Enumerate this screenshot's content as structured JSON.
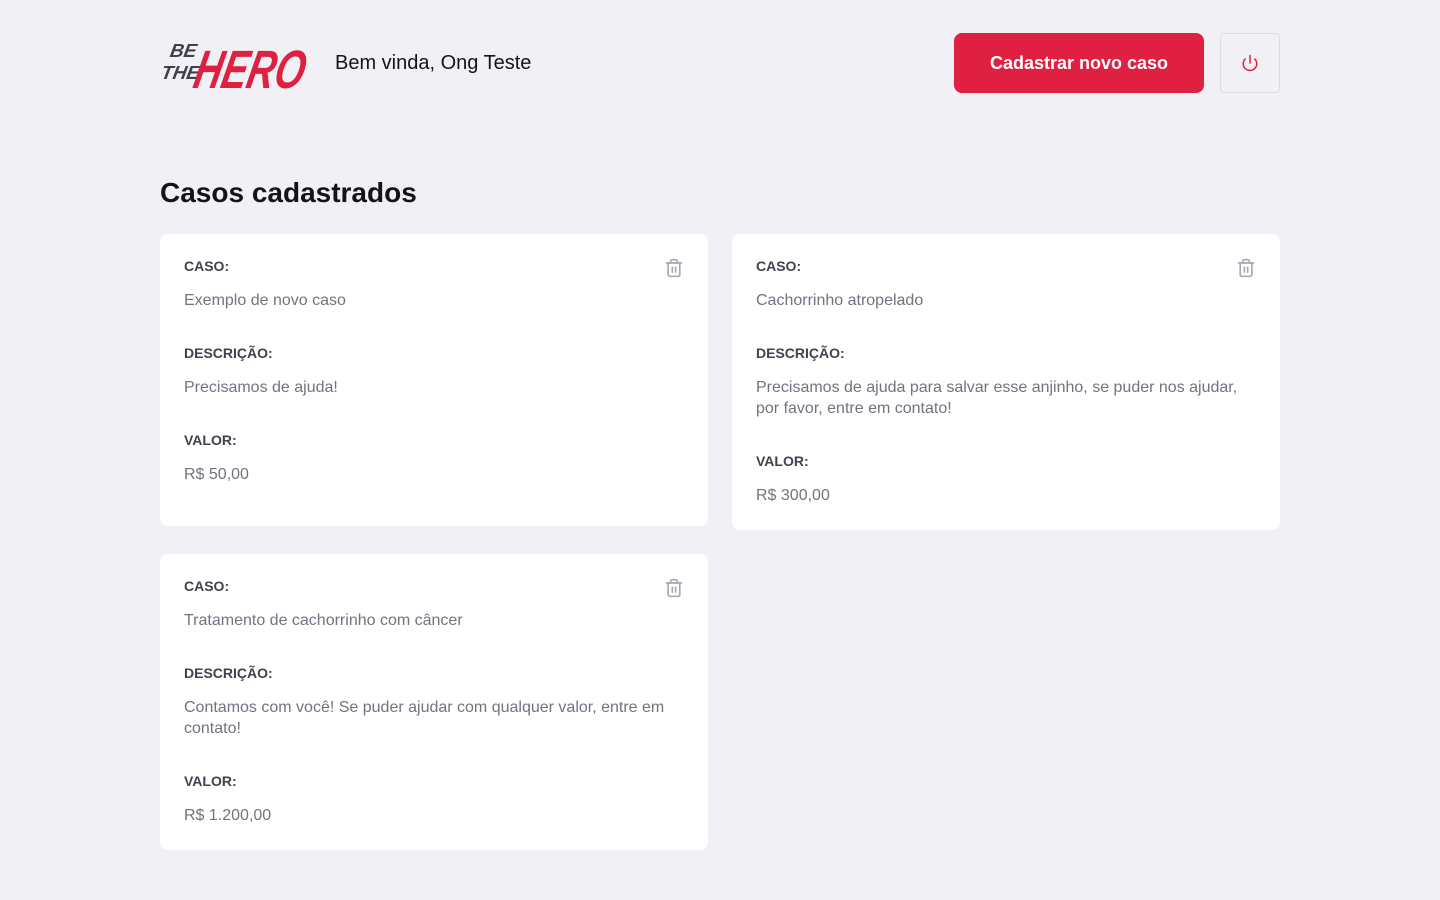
{
  "header": {
    "logo_alt": "Be The Hero",
    "logo_word_small_1": "BE",
    "logo_word_small_2": "THE",
    "logo_word_big": "HERO",
    "welcome": "Bem vinda, Ong Teste",
    "new_case_label": "Cadastrar novo caso",
    "logout_icon": "power-icon"
  },
  "page_title": "Casos cadastrados",
  "labels": {
    "case": "CASO:",
    "description": "DESCRIÇÃO:",
    "value": "VALOR:"
  },
  "cases": [
    {
      "title": "Exemplo de novo caso",
      "description": "Precisamos de ajuda!",
      "value": "R$ 50,00"
    },
    {
      "title": "Cachorrinho atropelado",
      "description": "Precisamos de ajuda para salvar esse anjinho, se puder nos ajudar, por favor, entre em contato!",
      "value": "R$ 300,00"
    },
    {
      "title": "Tratamento de cachorrinho com câncer",
      "description": "Contamos com você! Se puder ajudar com qualquer valor, entre em contato!",
      "value": "R$ 1.200,00"
    }
  ],
  "colors": {
    "brand": "#e02041",
    "background": "#f0f0f5",
    "label": "#41414d",
    "text": "#737380",
    "trash_icon": "#a8a8b3",
    "logo_dark": "#41414d"
  }
}
